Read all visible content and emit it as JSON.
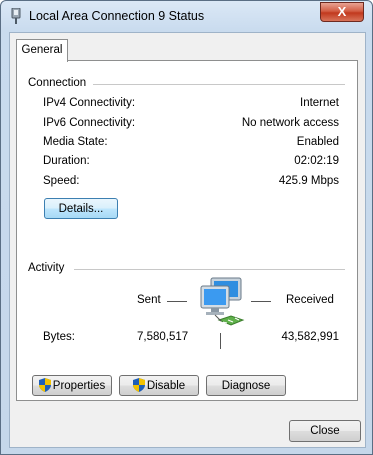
{
  "window": {
    "title": "Local Area Connection 9 Status",
    "close_glyph": "X"
  },
  "tabs": [
    {
      "label": "General",
      "active": true
    }
  ],
  "connection": {
    "heading": "Connection",
    "rows": [
      {
        "label": "IPv4 Connectivity:",
        "value": "Internet"
      },
      {
        "label": "IPv6 Connectivity:",
        "value": "No network access"
      },
      {
        "label": "Media State:",
        "value": "Enabled"
      },
      {
        "label": "Duration:",
        "value": "02:02:19"
      },
      {
        "label": "Speed:",
        "value": "425.9 Mbps"
      }
    ],
    "details_button": "Details..."
  },
  "activity": {
    "heading": "Activity",
    "sent_label": "Sent",
    "received_label": "Received",
    "bytes_label": "Bytes:",
    "bytes_sent": "7,580,517",
    "bytes_received": "43,582,991"
  },
  "actions": {
    "properties": "Properties",
    "disable": "Disable",
    "diagnose": "Diagnose"
  },
  "footer": {
    "close": "Close"
  },
  "icons": {
    "title": "network-adapter-icon",
    "activity": "network-computers-icon",
    "shield": "uac-shield-icon"
  },
  "colors": {
    "accent": "#3c7fb1",
    "close_red": "#c1391e"
  }
}
